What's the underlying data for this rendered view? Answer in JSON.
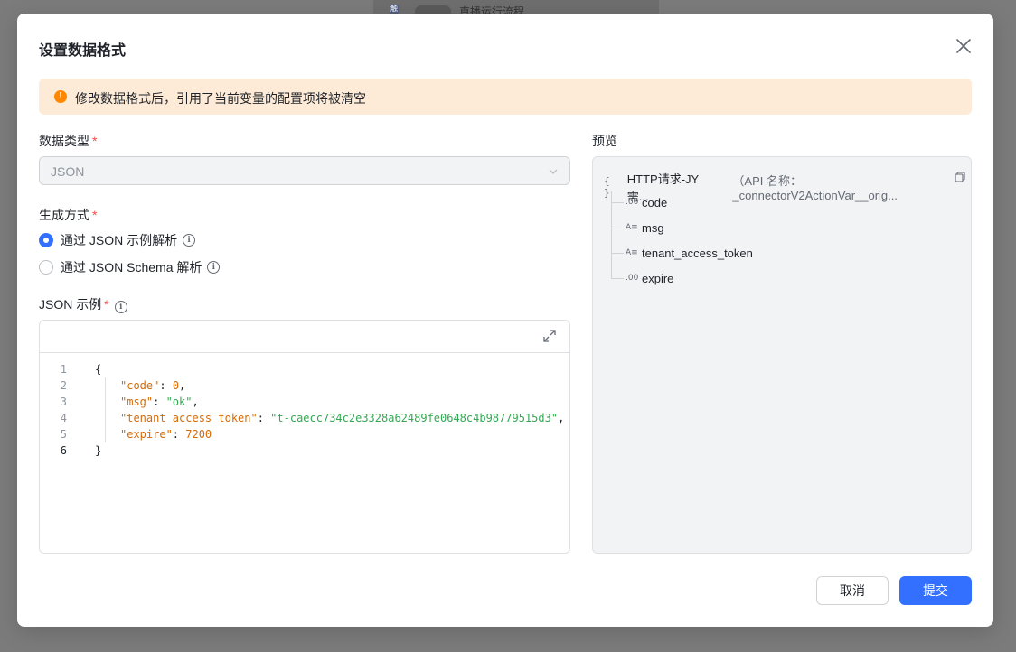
{
  "background": {
    "hint_text": "直播运行流程",
    "hint_badge": "触"
  },
  "modal": {
    "title": "设置数据格式"
  },
  "alert": {
    "icon": "warning-icon",
    "text": "修改数据格式后，引用了当前变量的配置项将被清空",
    "color": "#ff8800"
  },
  "data_type": {
    "label": "数据类型",
    "required_mark": "*",
    "value": "JSON"
  },
  "generate": {
    "label": "生成方式",
    "required_mark": "*",
    "options": [
      {
        "label": "通过 JSON 示例解析",
        "checked": true
      },
      {
        "label": "通过 JSON Schema 解析",
        "checked": false
      }
    ]
  },
  "example": {
    "label": "JSON 示例",
    "required_mark": "*",
    "line_numbers": [
      "1",
      "2",
      "3",
      "4",
      "5",
      "6"
    ],
    "code": {
      "open": "{",
      "close": "}",
      "lines": [
        {
          "key": "\"code\"",
          "sep": ": ",
          "value": "0",
          "trail": ","
        },
        {
          "key": "\"msg\"",
          "sep": ": ",
          "value": "\"ok\"",
          "trail": ","
        },
        {
          "key": "\"tenant_access_token\"",
          "sep": ": ",
          "value": "\"t-caecc734c2e3328a62489fe0648c4b98779515d3\"",
          "trail": ","
        },
        {
          "key": "\"expire\"",
          "sep": ": ",
          "value": "7200",
          "trail": ""
        }
      ]
    }
  },
  "preview": {
    "label": "预览",
    "root_icon": "{ }",
    "root_name": "HTTP请求-JY需...",
    "root_api": "（API 名称：_connectorV2ActionVar__orig...",
    "fields": [
      {
        "type_icon": ".00",
        "name": "code"
      },
      {
        "type_icon": "A≡",
        "name": "msg"
      },
      {
        "type_icon": "A≡",
        "name": "tenant_access_token"
      },
      {
        "type_icon": ".00",
        "name": "expire"
      }
    ]
  },
  "footer": {
    "cancel_label": "取消",
    "submit_label": "提交",
    "accent_color": "#3370ff"
  }
}
